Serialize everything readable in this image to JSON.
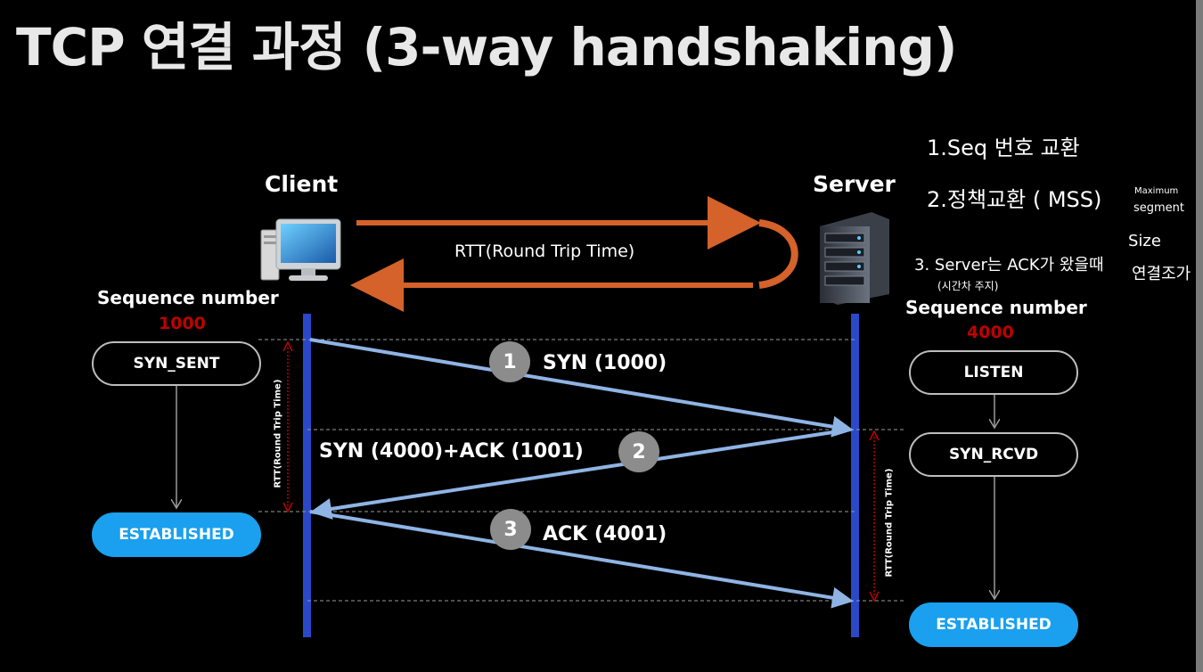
{
  "title": "TCP 연결 과정 (3-way handshaking)",
  "client": {
    "label": "Client",
    "seq_label": "Sequence number",
    "seq_value": "1000",
    "states": [
      "SYN_SENT",
      "ESTABLISHED"
    ]
  },
  "server": {
    "label": "Server",
    "seq_label": "Sequence number",
    "seq_value": "4000",
    "states": [
      "LISTEN",
      "SYN_RCVD",
      "ESTABLISHED"
    ]
  },
  "rtt_label": "RTT(Round Trip Time)",
  "rtt_vertical_label": "RTT(Round Trip Time)",
  "messages": [
    {
      "step": "1",
      "label": "SYN (1000)"
    },
    {
      "step": "2",
      "label": "SYN (4000)+ACK (1001)"
    },
    {
      "step": "3",
      "label": "ACK (4001)"
    }
  ],
  "handwritten_notes": {
    "note1": "1.Seq 번호 교환",
    "note2": "2.정책교환 ( MSS)",
    "note2_side": [
      "Maximum",
      "segment",
      "Size"
    ],
    "note3": "3. Server는 ACK가 왔을때",
    "note3_right": "연결조가",
    "note3_sub": "(시간차 주지)"
  },
  "colors": {
    "orange_arrow": "#d4622a",
    "lifeline": "#2a49c9",
    "msg_arrow": "#8fb4e4",
    "state_est": "#1aa0ee",
    "seq_red": "#c00000",
    "rtt_red": "#c00000"
  }
}
